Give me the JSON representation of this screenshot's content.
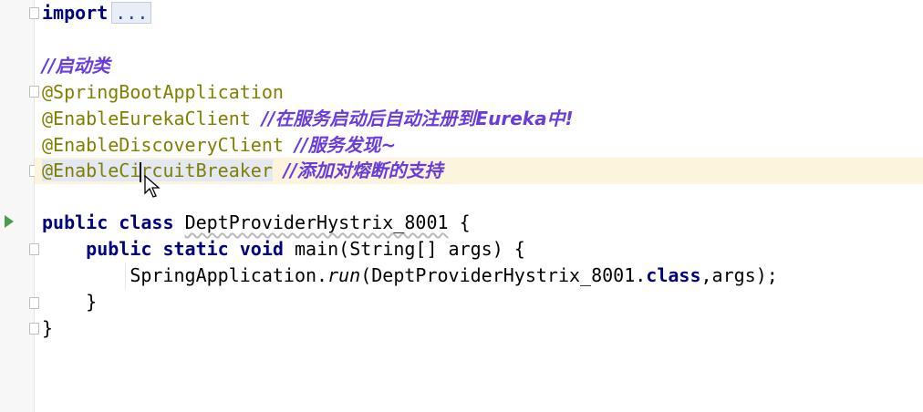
{
  "code": {
    "import_kw": "import",
    "import_fold": "...",
    "comment_startup": "//启动类",
    "ann_springboot": "@SpringBootApplication",
    "ann_eureka": "@EnableEurekaClient",
    "comment_eureka": "//在服务启动后自动注册到Eureka中!",
    "ann_discovery": "@EnableDiscoveryClient",
    "comment_discovery": "//服务发现~",
    "ann_circuit_a": "@EnableCi",
    "ann_circuit_b": "rcuitBreaker",
    "comment_circuit": "//添加对熔断的支持",
    "kw_public": "public",
    "kw_class": "class",
    "class_name": "DeptProviderHystrix_8001",
    "brace_open": " {",
    "kw_static": "static",
    "kw_void": "void",
    "main_sig": "main(String[] args) {",
    "spring_app": "SpringApplication.",
    "run_method": "run",
    "run_args_a": "(DeptProviderHystrix_8001.",
    "kw_class2": "class",
    "run_args_b": ",args);",
    "brace_close_inner": "}",
    "brace_close_outer": "}"
  },
  "colors": {
    "keyword": "#000080",
    "annotation": "#808000",
    "comment": "#6a3cdc",
    "current_line": "#fcf4dc"
  }
}
